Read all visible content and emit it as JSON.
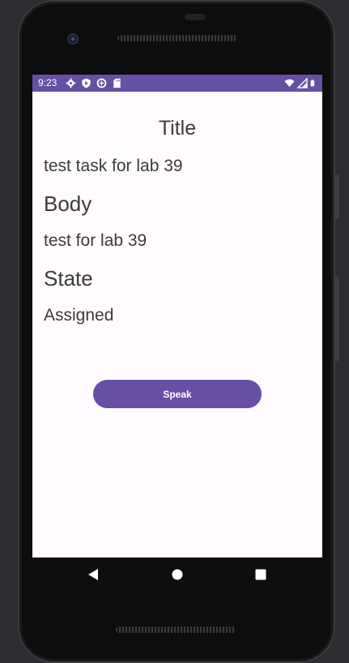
{
  "status_bar": {
    "time": "9:23",
    "background_color": "#6650a4",
    "left_icons": [
      "settings-icon",
      "play-protect-icon",
      "data-saver-icon",
      "sd-card-icon"
    ],
    "right_icons": [
      "wifi-icon",
      "signal-icon",
      "battery-icon"
    ]
  },
  "screen": {
    "background_color": "#fffbfe",
    "title_heading": "Title",
    "title_value": "test task for lab 39",
    "body_heading": "Body",
    "body_value": "test for lab 39",
    "state_heading": "State",
    "state_value": "Assigned",
    "speak_button_label": "Speak",
    "accent_color": "#6750a4"
  },
  "nav_bar": {
    "buttons": [
      "back-icon",
      "home-icon",
      "recents-icon"
    ]
  }
}
